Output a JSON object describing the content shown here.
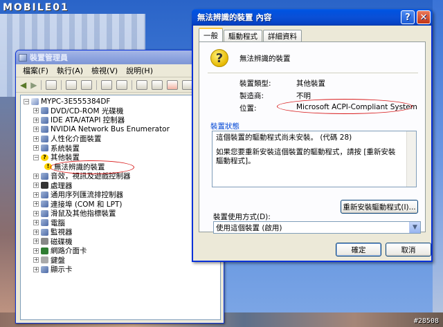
{
  "background": {
    "sign_text": "MOBILE01",
    "watermark": "#28508"
  },
  "device_manager": {
    "title": "裝置管理員",
    "menu": [
      "檔案(F)",
      "執行(A)",
      "檢視(V)",
      "說明(H)"
    ],
    "tree": {
      "root": "MYPC-3E555384DF",
      "items": [
        {
          "label": "DVD/CD-ROM 光碟機",
          "icon": "dvd-icon"
        },
        {
          "label": "IDE ATA/ATAPI 控制器",
          "icon": "ide-icon"
        },
        {
          "label": "NVIDIA Network Bus Enumerator",
          "icon": "network-bus-icon"
        },
        {
          "label": "人性化介面裝置",
          "icon": "hid-icon"
        },
        {
          "label": "系統裝置",
          "icon": "system-device-icon"
        },
        {
          "label": "其他裝置",
          "icon": "unknown-device-icon",
          "expanded": true,
          "children": [
            {
              "label": "無法辨識的裝置",
              "icon": "question-mark-icon"
            }
          ]
        },
        {
          "label": "音效，視訊及遊戲控制器",
          "icon": "audio-icon"
        },
        {
          "label": "處理器",
          "icon": "processor-icon"
        },
        {
          "label": "通用序列匯流排控制器",
          "icon": "usb-icon"
        },
        {
          "label": "連接埠 (COM 和 LPT)",
          "icon": "port-icon"
        },
        {
          "label": "滑鼠及其他指標裝置",
          "icon": "mouse-icon"
        },
        {
          "label": "電腦",
          "icon": "computer-icon"
        },
        {
          "label": "監視器",
          "icon": "monitor-icon"
        },
        {
          "label": "磁碟機",
          "icon": "disk-icon"
        },
        {
          "label": "網路介面卡",
          "icon": "network-adapter-icon"
        },
        {
          "label": "鍵盤",
          "icon": "keyboard-icon"
        },
        {
          "label": "顯示卡",
          "icon": "display-adapter-icon"
        }
      ]
    }
  },
  "properties_dialog": {
    "title": "無法辨識的裝置 內容",
    "tabs": [
      "一般",
      "驅動程式",
      "詳細資料"
    ],
    "active_tab": "一般",
    "device_name": "無法辨識的裝置",
    "properties": [
      {
        "label": "裝置類型:",
        "value": "其他裝置"
      },
      {
        "label": "製造商:",
        "value": "不明"
      },
      {
        "label": "位置:",
        "value": "Microsoft ACPI-Compliant System"
      }
    ],
    "status_group_title": "裝置狀態",
    "status_text_1": "這個裝置的驅動程式尚未安裝。 (代碼 28)",
    "status_text_2": "如果您要重新安裝這個裝置的驅動程式，請按 [重新安裝驅動程式]。",
    "reinstall_button": "重新安裝驅動程式(I)...",
    "usage_label": "裝置使用方式(D):",
    "usage_value": "使用這個裝置 (啟用)",
    "ok_button": "確定",
    "cancel_button": "取消"
  }
}
